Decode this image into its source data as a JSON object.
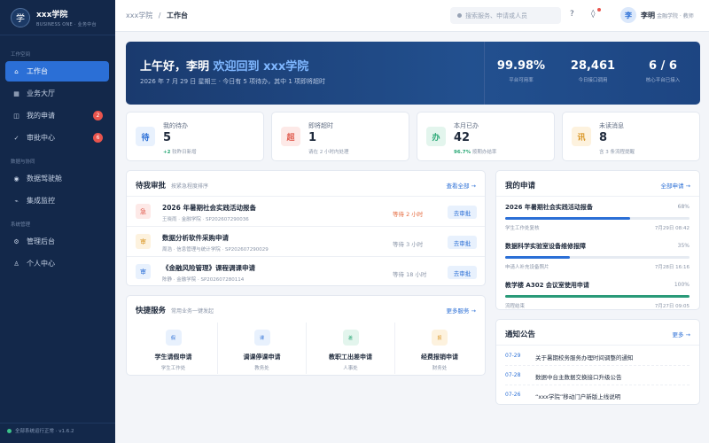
{
  "brand": {
    "logo": "学",
    "title": "xxx学院",
    "subtitle": "BUSINESS ONE · 业务中台"
  },
  "sidebar": {
    "sections": [
      "工作空间",
      "数据与协同",
      "系统管理"
    ],
    "items": [
      {
        "label": "工作台",
        "icon": "home-icon",
        "glyph": "⌂"
      },
      {
        "label": "业务大厅",
        "icon": "grid-icon",
        "glyph": "▦"
      },
      {
        "label": "我的申请",
        "icon": "document-icon",
        "glyph": "◫",
        "badge": "2"
      },
      {
        "label": "审批中心",
        "icon": "check-icon",
        "glyph": "✓",
        "badge": "6"
      },
      {
        "label": "数据驾驶舱",
        "icon": "dashboard-icon",
        "glyph": "◉"
      },
      {
        "label": "集成监控",
        "icon": "pulse-icon",
        "glyph": "⌁"
      },
      {
        "label": "管理后台",
        "icon": "gear-icon",
        "glyph": "⚙"
      },
      {
        "label": "个人中心",
        "icon": "user-icon",
        "glyph": "♙"
      }
    ],
    "status": "全部系统运行正常 · v1.6.2"
  },
  "header": {
    "breadcrumb_root": "xxx学院",
    "breadcrumb_sep": "/",
    "breadcrumb_current": "工作台",
    "search_placeholder": "搜索服务、申请或人员",
    "help_glyph": "?",
    "notify_glyph": "◊",
    "avatar": "李",
    "user_name": "李明",
    "user_role": "金融学院 · 教师"
  },
  "hero": {
    "greeting": "上午好，李明",
    "welcome": "欢迎回到 xxx学院",
    "subtitle": "2026 年 7 月 29 日 星期三 · 今日有 5 项待办，其中 1 项即将超时",
    "stats": [
      {
        "value": "99.98%",
        "label": "平台可用率"
      },
      {
        "value": "28,461",
        "label": "今日接口调用"
      },
      {
        "value": "6 / 6",
        "label": "核心平台已接入"
      }
    ]
  },
  "cards": [
    {
      "icon": "待",
      "title": "我的待办",
      "value": "5",
      "note_hl": "+2",
      "note": " 较昨日新增",
      "fg": "#2b6fd6",
      "bg": "#e8f1fd"
    },
    {
      "icon": "超",
      "title": "即将超时",
      "value": "1",
      "note_hl": "",
      "note": "请在 2 小时内处理",
      "fg": "#e05a4d",
      "bg": "#fde9e7"
    },
    {
      "icon": "办",
      "title": "本月已办",
      "value": "42",
      "note_hl": "96.7%",
      "note": " 按期办结率",
      "fg": "#2aa876",
      "bg": "#e3f5ed"
    },
    {
      "icon": "讯",
      "title": "未读消息",
      "value": "8",
      "note_hl": "",
      "note": "含 3 条流程提醒",
      "fg": "#d99523",
      "bg": "#fdf2de"
    }
  ],
  "approvals": {
    "title": "待我审批",
    "subtitle": "按紧急程度排序",
    "link": "查看全部 →",
    "rows": [
      {
        "icon": "急",
        "fg": "#e05a4d",
        "bg": "#fde9e7",
        "title": "2026 年暑期社会实践活动报备",
        "meta": "王晓雨 · 金融学院 · SP202607290036",
        "wait": "等待 2 小时",
        "urgent": true,
        "action": "去审批"
      },
      {
        "icon": "审",
        "fg": "#d99523",
        "bg": "#fdf2de",
        "title": "数据分析软件采购申请",
        "meta": "周浩 · 信息管理与统计学院 · SP202607290029",
        "wait": "等待 3 小时",
        "urgent": false,
        "action": "去审批"
      },
      {
        "icon": "审",
        "fg": "#2b6fd6",
        "bg": "#e8f1fd",
        "title": "《金融风险管理》课程调课申请",
        "meta": "陈静 · 金融学院 · SP202607280114",
        "wait": "等待 18 小时",
        "urgent": false,
        "action": "去审批"
      }
    ]
  },
  "services": {
    "title": "快捷服务",
    "subtitle": "常用业务一键发起",
    "link": "更多服务 →",
    "items": [
      {
        "glyph": "假",
        "name": "学生请假申请",
        "dept": "学生工作处",
        "fg": "#2b6fd6",
        "bg": "#e8f1fd"
      },
      {
        "glyph": "课",
        "name": "调课停课申请",
        "dept": "教务处",
        "fg": "#2b6fd6",
        "bg": "#e8f1fd"
      },
      {
        "glyph": "差",
        "name": "教职工出差申请",
        "dept": "人事处",
        "fg": "#2aa876",
        "bg": "#e3f5ed"
      },
      {
        "glyph": "报",
        "name": "经费报销申请",
        "dept": "财务处",
        "fg": "#d99523",
        "bg": "#fdf2de"
      }
    ]
  },
  "applications": {
    "title": "我的申请",
    "link": "全部申请 →",
    "items": [
      {
        "title": "2026 年暑期社会实践活动报备",
        "pct": "68%",
        "progress": 0.68,
        "color": "#2b6fd6",
        "meta": "学生工作处复核",
        "time": "7月29日 08:42"
      },
      {
        "title": "数据科学实验室设备维修报障",
        "pct": "35%",
        "progress": 0.35,
        "color": "#2b6fd6",
        "meta": "申请人补充设备照片",
        "time": "7月28日 16:16"
      },
      {
        "title": "教学楼 A302 会议室使用申请",
        "pct": "100%",
        "progress": 1.0,
        "color": "#2a9a78",
        "meta": "流程结束",
        "time": "7月27日 09:05"
      }
    ]
  },
  "notices": {
    "title": "通知公告",
    "link": "更多 →",
    "items": [
      {
        "date": "07-29",
        "text": "关于暑期校务服务办理时间调整的通知"
      },
      {
        "date": "07-28",
        "text": "数据中台主数据交换接口升级公告"
      },
      {
        "date": "07-26",
        "text": "“xxx学院”移动门户新版上线说明"
      }
    ]
  }
}
